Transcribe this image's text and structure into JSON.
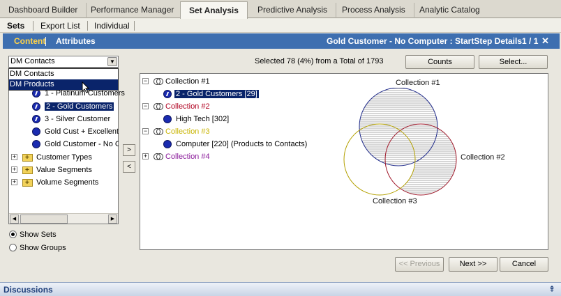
{
  "top_tabs": [
    {
      "label": "Dashboard Builder"
    },
    {
      "label": "Performance Manager"
    },
    {
      "label": "Set Analysis"
    },
    {
      "label": "Predictive Analysis"
    },
    {
      "label": "Process Analysis"
    },
    {
      "label": "Analytic Catalog"
    }
  ],
  "sub_tabs": [
    {
      "label": "Sets"
    },
    {
      "label": "Export List"
    },
    {
      "label": "Individual"
    }
  ],
  "header": {
    "content_label": "Content",
    "attributes_label": "Attributes",
    "title": "Gold Customer - No Computer :  StartStep Details1 / 1",
    "close_glyph": "✕",
    "bar_color": "#3e6fb0"
  },
  "left": {
    "combo_value": "DM Contacts",
    "dropdown_options": [
      "DM Contacts",
      "DM Products"
    ],
    "tree": {
      "sets": [
        {
          "label": "1 - Platinum Customers"
        },
        {
          "label": "2 - Gold Customers"
        },
        {
          "label": "3 - Silver Customer"
        },
        {
          "label": "Gold Cust + Excellent"
        },
        {
          "label": "Gold Customer - No Computer"
        }
      ],
      "folders": [
        {
          "label": "Customer Types"
        },
        {
          "label": "Value Segments"
        },
        {
          "label": "Volume Segments"
        }
      ]
    },
    "radios": {
      "show_sets": "Show Sets",
      "show_groups": "Show Groups"
    }
  },
  "move": {
    "right": ">",
    "left": "<"
  },
  "summary": {
    "selected_text": "Selected 78 (4%)  from a Total of  1793"
  },
  "buttons": {
    "counts": "Counts",
    "select": "Select...",
    "previous": "<< Previous",
    "next": "Next >>",
    "cancel": "Cancel"
  },
  "collections": [
    {
      "label": "Collection #1",
      "color": "#1a1aa0",
      "item": "2 - Gold Customers [29]"
    },
    {
      "label": "Collection #2",
      "color": "#b00020",
      "item": "High Tech [302]"
    },
    {
      "label": "Collection #3",
      "color": "#c8b400",
      "item": "Computer [220]   (Products to Contacts)"
    },
    {
      "label": "Collection #4",
      "color": "#8a1a9a"
    }
  ],
  "venn": {
    "label1": "Collection #1",
    "label2": "Collection #2",
    "label3": "Collection #3",
    "color1": "#1f2a8a",
    "color2": "#a0182a",
    "color3": "#b3a000"
  },
  "footer": {
    "discussions": "Discussions",
    "pin_glyph": "⇞"
  }
}
